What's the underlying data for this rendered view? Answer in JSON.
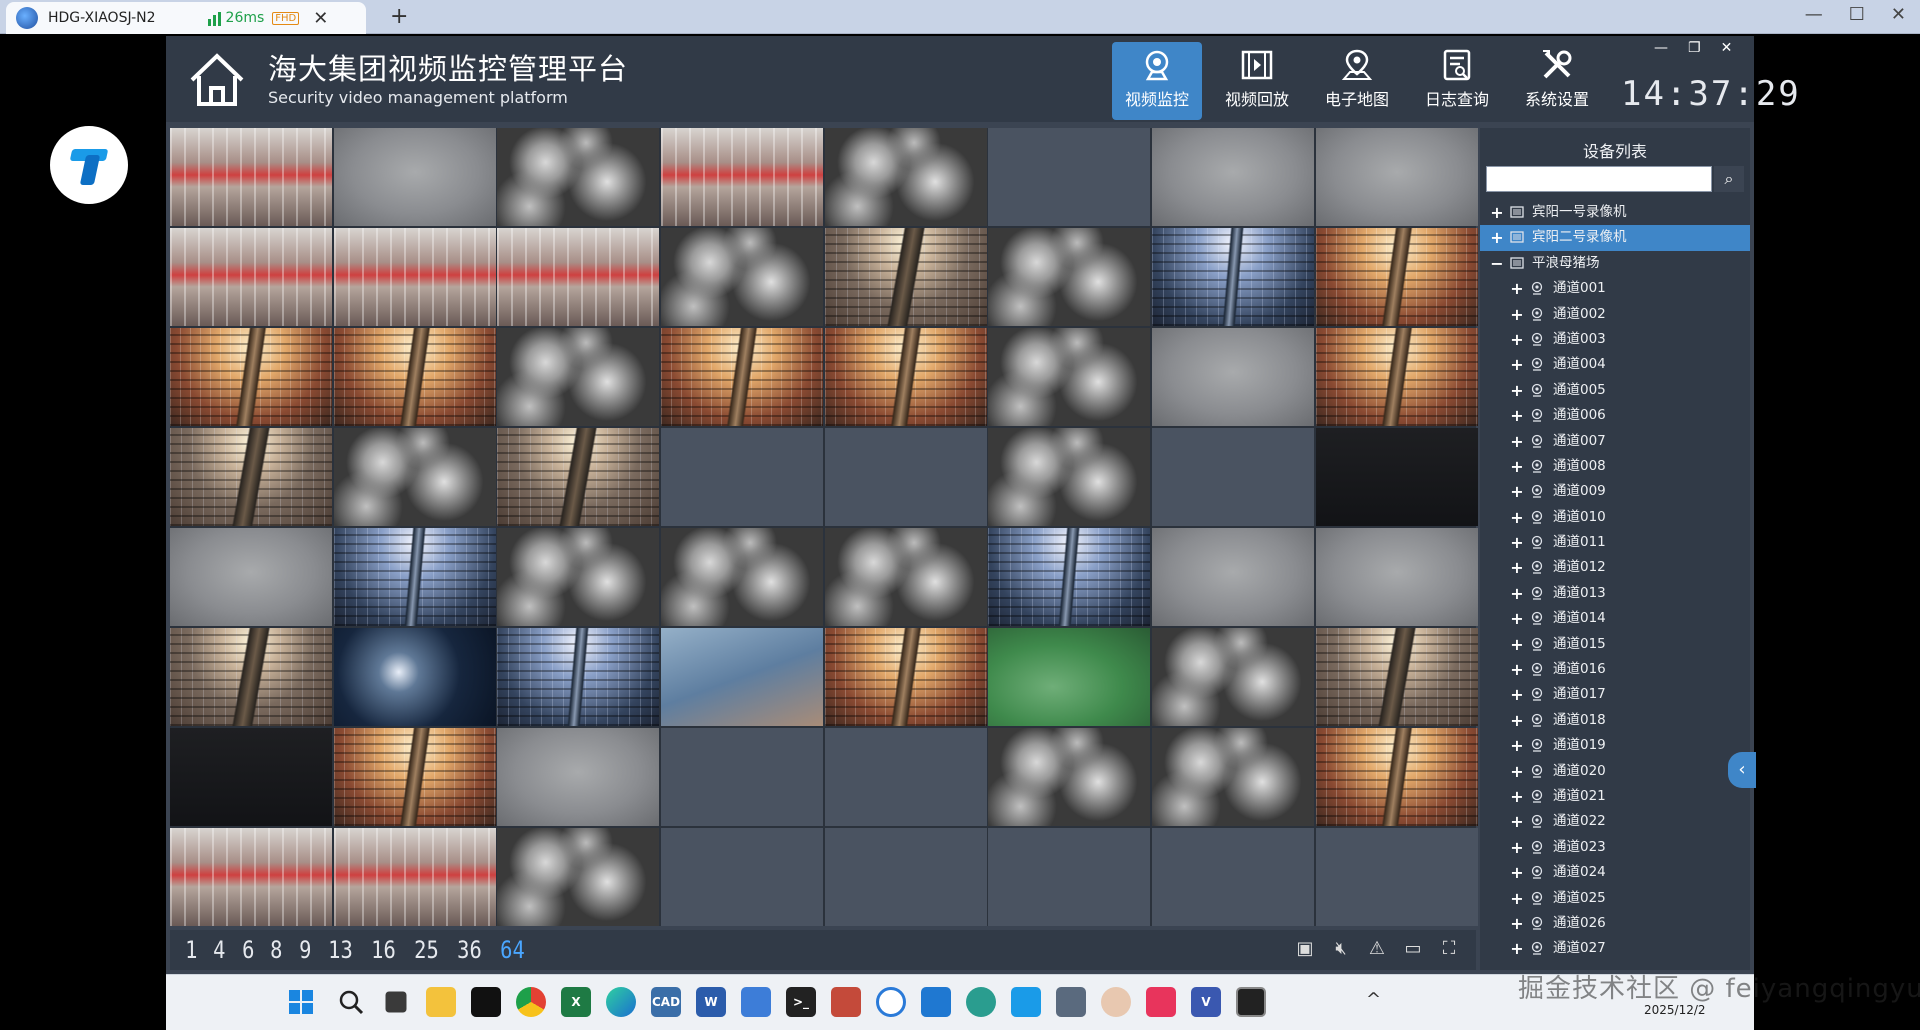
{
  "client_tab": {
    "title": "HDG-XIAOSJ-N2",
    "latency": "26ms",
    "quality_badge": "FHD"
  },
  "app": {
    "title_cn": "海大集团视频监控管理平台",
    "title_en": "Security video management platform",
    "clock": "14:37:29",
    "nav": [
      {
        "label": "视频监控",
        "icon": "camera-icon",
        "active": true
      },
      {
        "label": "视频回放",
        "icon": "film-icon",
        "active": false
      },
      {
        "label": "电子地图",
        "icon": "map-pin-icon",
        "active": false
      },
      {
        "label": "日志查询",
        "icon": "log-icon",
        "active": false
      },
      {
        "label": "系统设置",
        "icon": "tools-icon",
        "active": false
      }
    ]
  },
  "layouts": {
    "options": [
      "1",
      "4",
      "6",
      "8",
      "9",
      "13",
      "16",
      "25",
      "36",
      "64"
    ],
    "selected": "64"
  },
  "grid_cells": [
    "crate",
    "grey",
    "night",
    "crate",
    "night",
    "empty",
    "grey",
    "grey",
    "crate",
    "crate",
    "crate",
    "night",
    "farm",
    "night",
    "blue",
    "warm",
    "warm",
    "warm",
    "night",
    "warm",
    "warm",
    "night",
    "grey",
    "warm",
    "farm",
    "night",
    "farm",
    "empty",
    "empty",
    "night",
    "empty",
    "dark",
    "grey",
    "blue",
    "night",
    "night",
    "night",
    "blue",
    "grey",
    "grey",
    "farm",
    "navy",
    "blue",
    "haze",
    "warm",
    "green",
    "night",
    "farm",
    "dark",
    "warm",
    "grey",
    "empty",
    "empty",
    "night",
    "night",
    "warm",
    "crate",
    "crate",
    "night",
    "empty",
    "empty",
    "empty",
    "empty",
    "empty"
  ],
  "device_panel": {
    "title": "设备列表",
    "search_placeholder": "",
    "recorders": [
      {
        "label": "宾阳一号录像机",
        "expander": "+",
        "selected": false
      },
      {
        "label": "宾阳二号录像机",
        "expander": "+",
        "selected": true
      },
      {
        "label": "平浪母猪场",
        "expander": "−",
        "selected": false
      }
    ],
    "channels": [
      "通道001",
      "通道002",
      "通道003",
      "通道004",
      "通道005",
      "通道006",
      "通道007",
      "通道008",
      "通道009",
      "通道010",
      "通道011",
      "通道012",
      "通道013",
      "通道014",
      "通道015",
      "通道016",
      "通道017",
      "通道018",
      "通道019",
      "通道020",
      "通道021",
      "通道022",
      "通道023",
      "通道024",
      "通道025",
      "通道026",
      "通道027"
    ]
  },
  "taskbar": {
    "date": "2025/12/2"
  },
  "watermark": "掘金技术社区 @ feiyangqingyun",
  "colors": {
    "accent": "#3f86c8",
    "header_bg": "#313a47",
    "app_bg": "#3b4452",
    "selected_layout": "#4aa6ff"
  }
}
